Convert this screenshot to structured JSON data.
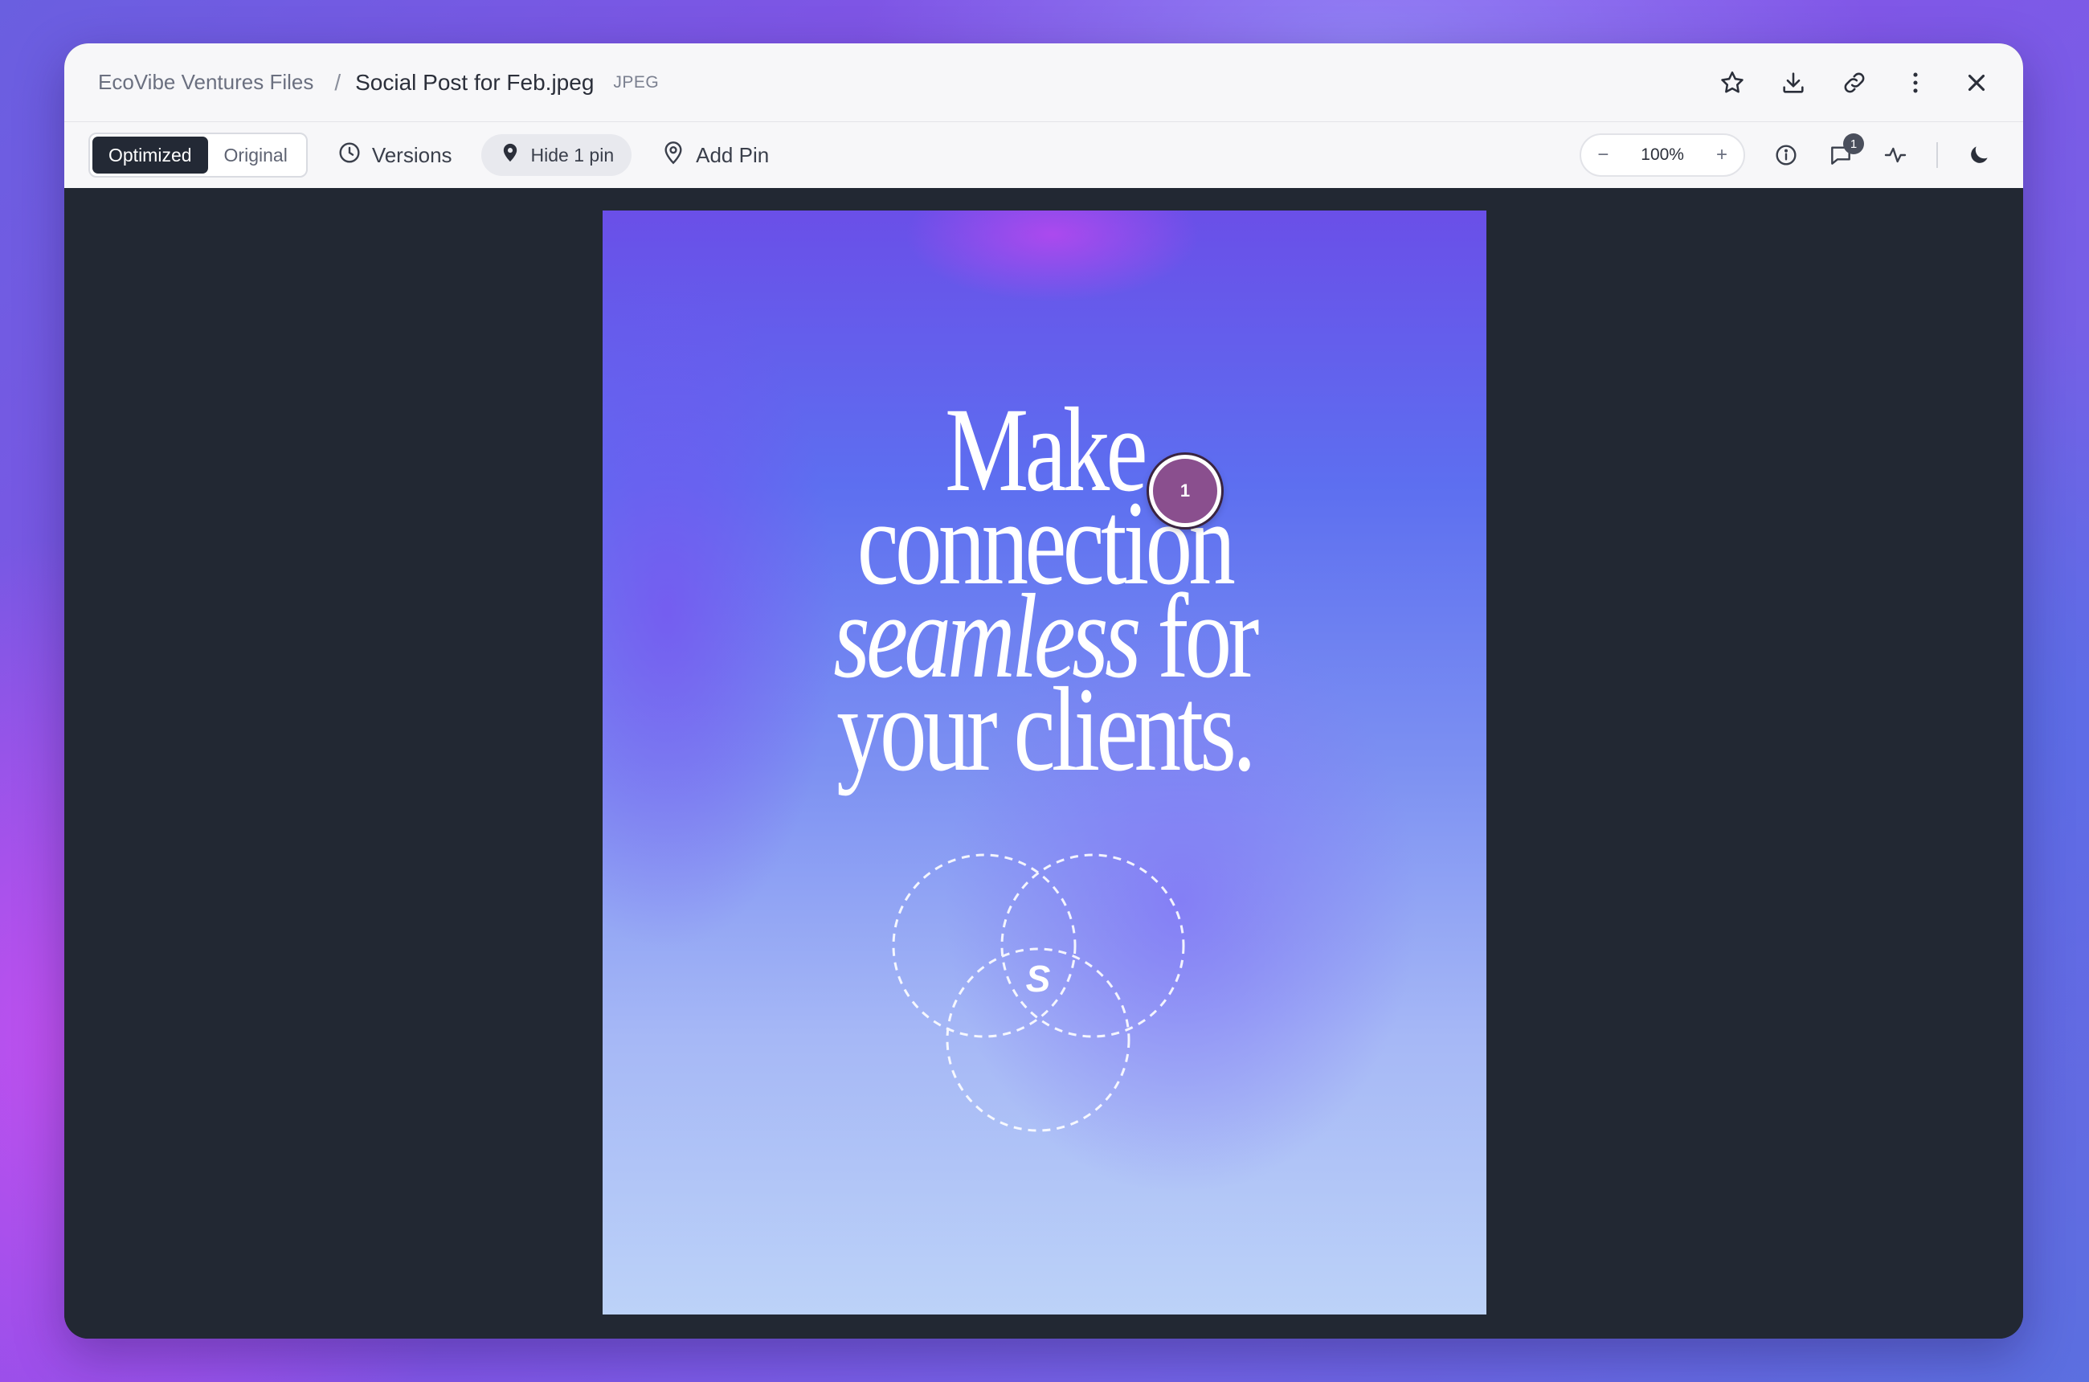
{
  "breadcrumb": {
    "root": "EcoVibe Ventures Files",
    "separator": "/",
    "file_name": "Social Post for Feb.jpeg",
    "file_type": "JPEG"
  },
  "title_actions": [
    "star-icon",
    "download-icon",
    "link-icon",
    "more-vertical-icon",
    "close-icon"
  ],
  "toolbar": {
    "view_mode": {
      "options": [
        "Optimized",
        "Original"
      ],
      "selected": "Optimized"
    },
    "versions_label": "Versions",
    "hide_pins_label": "Hide 1 pin",
    "add_pin_label": "Add Pin",
    "zoom": {
      "minus": "−",
      "value": "100%",
      "plus": "+"
    },
    "comments_count": "1",
    "icons": [
      "clock-icon",
      "pin-filled-icon",
      "pin-outline-icon",
      "info-icon",
      "comment-icon",
      "activity-icon",
      "moon-icon"
    ]
  },
  "artwork": {
    "line1": "Make",
    "line2": "connection",
    "line3_italic": "seamless",
    "line3_rest": " for",
    "line4": "your clients.",
    "logo_glyph": "S"
  },
  "pin": {
    "number": "1",
    "color": "#8a4f8e"
  },
  "colors": {
    "window_bg": "#222833",
    "toolbar_bg": "#f7f7f9",
    "active_segment": "#232935"
  }
}
